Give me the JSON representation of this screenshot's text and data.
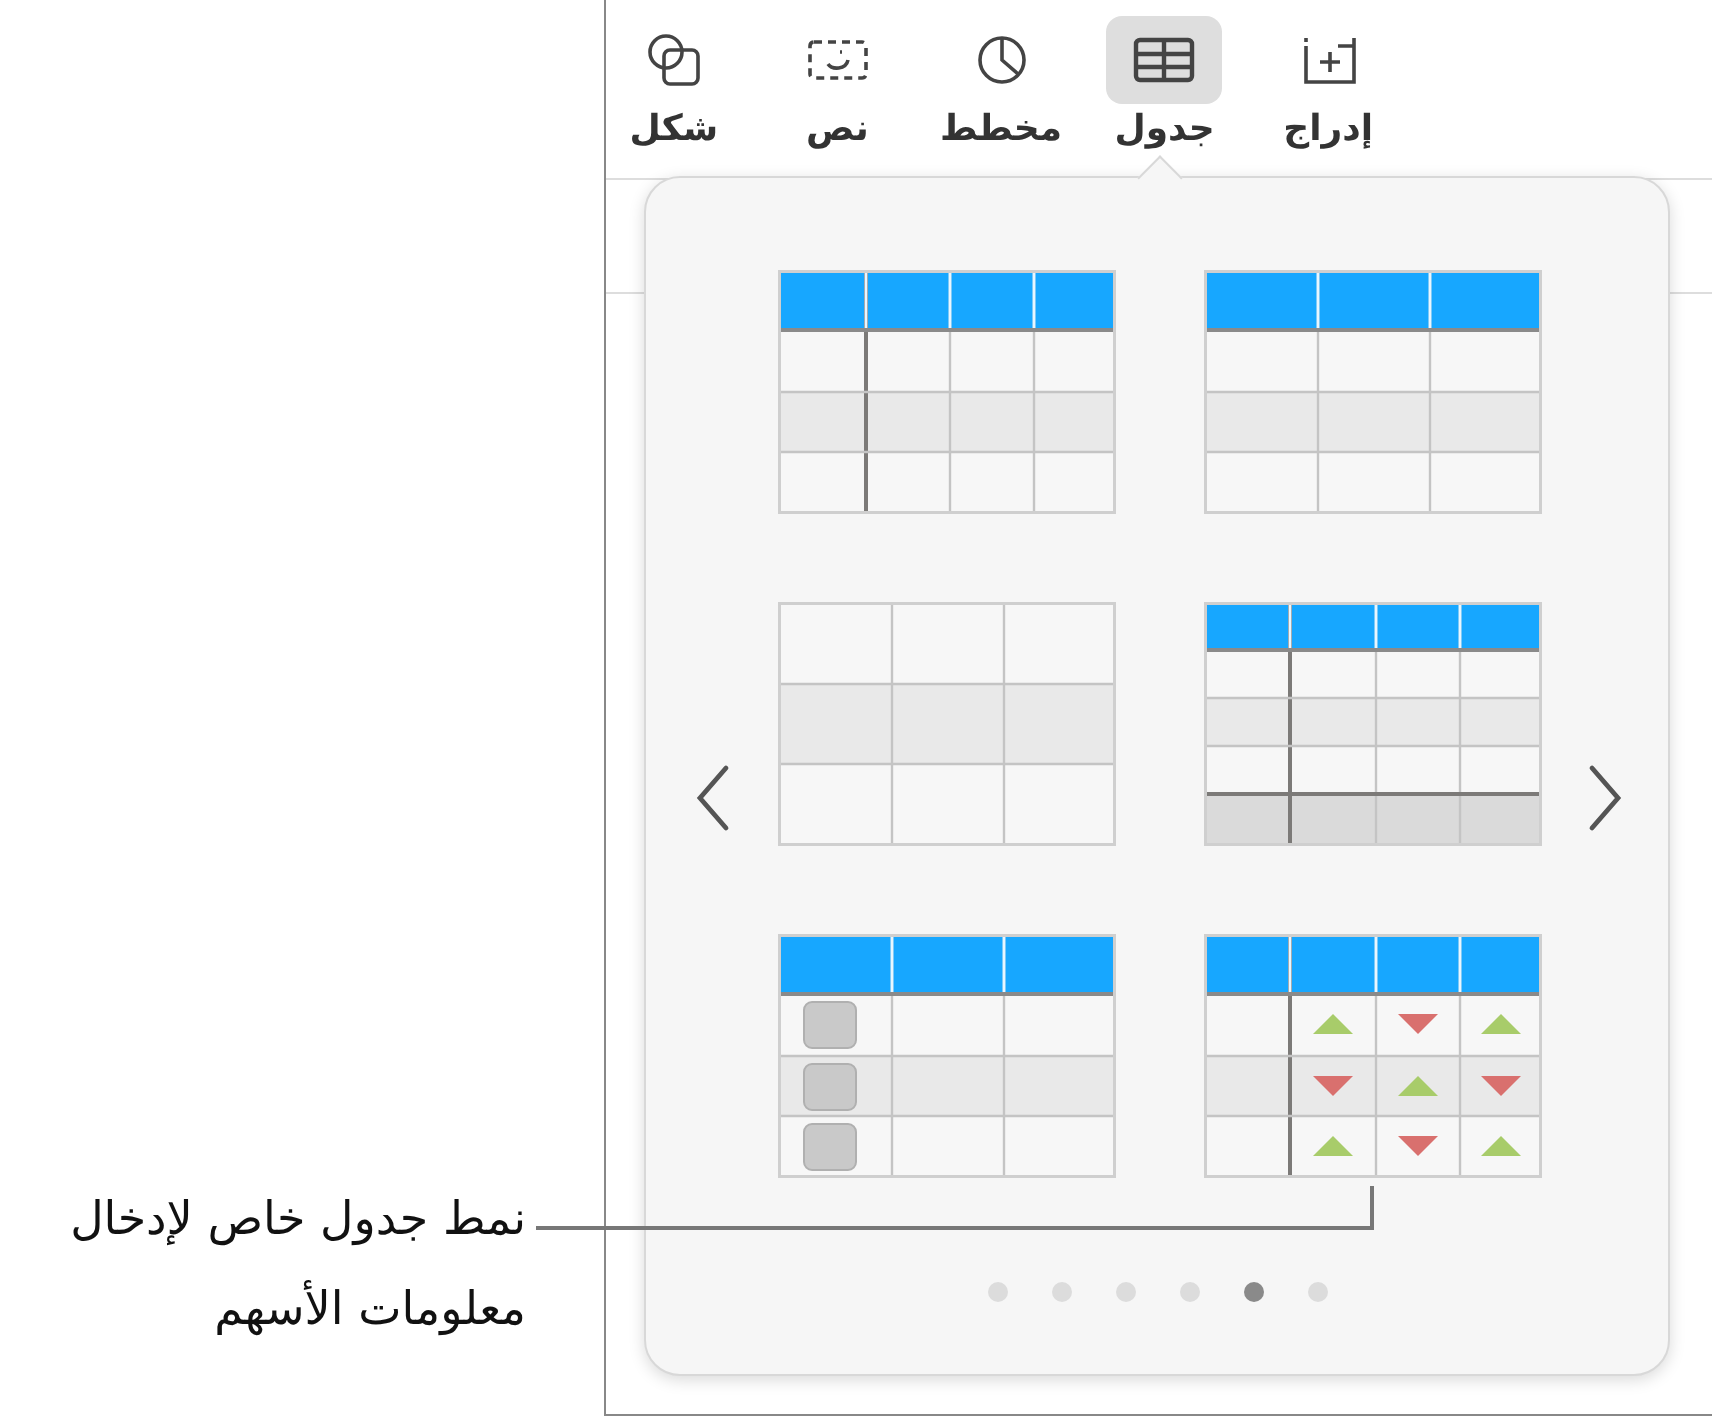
{
  "toolbar": [
    {
      "label": "إدراج",
      "kind": "insert",
      "selected": false
    },
    {
      "label": "جدول",
      "kind": "table",
      "selected": true
    },
    {
      "label": "مخطط",
      "kind": "chart",
      "selected": false
    },
    {
      "label": "نص",
      "kind": "text",
      "selected": false
    },
    {
      "label": "شكل",
      "kind": "shape",
      "selected": false
    }
  ],
  "table_styles": [
    {
      "kind": "header-column"
    },
    {
      "kind": "header"
    },
    {
      "kind": "plain"
    },
    {
      "kind": "header-column-footer"
    },
    {
      "kind": "checkbox"
    },
    {
      "kind": "stock"
    }
  ],
  "pages": [
    {
      "selected": false
    },
    {
      "selected": false
    },
    {
      "selected": false
    },
    {
      "selected": false
    },
    {
      "selected": true
    },
    {
      "selected": false
    }
  ],
  "callout": "نمط جدول خاص لإدخال معلومات الأسهم"
}
